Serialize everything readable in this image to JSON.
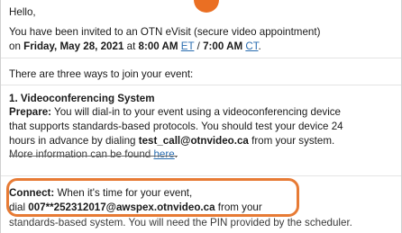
{
  "email": {
    "greeting": "Hello,",
    "invite_line1": "You have been invited to an OTN eVisit (secure video appointment)",
    "invite_on": "on ",
    "invite_date": "Friday, May 28, 2021",
    "invite_at": " at ",
    "invite_time1": "8:00 AM",
    "tz1": "ET",
    "slash": " / ",
    "invite_time2": "7:00 AM",
    "tz2": "CT",
    "period": ".",
    "ways_text": "There are three ways to join your event:",
    "section_title": "1. Videoconferencing System",
    "prepare_label": "Prepare:",
    "prepare_line1": " You will dial-in to your event using a videoconferencing device",
    "prepare_line2": "that supports standards-based protocols. You should test your device 24",
    "prepare_line3_a": "hours in advance by dialing ",
    "test_call": "test_call@otnvideo.ca",
    "prepare_line3_b": " from your system.",
    "more_info_a": "More information can be found ",
    "more_info_link": "here",
    "more_info_b": ".",
    "connect_label": "Connect:",
    "connect_line1": " When it's time for your event,",
    "dial_word": "dial ",
    "dial_address": "007**252312017@awspex.otnvideo.ca",
    "connect_line2_b": " from your",
    "bottom_line": "standards-based system. You will need the PIN provided by the scheduler."
  },
  "colors": {
    "accent": "#e77b35",
    "link": "#2a6db0"
  }
}
